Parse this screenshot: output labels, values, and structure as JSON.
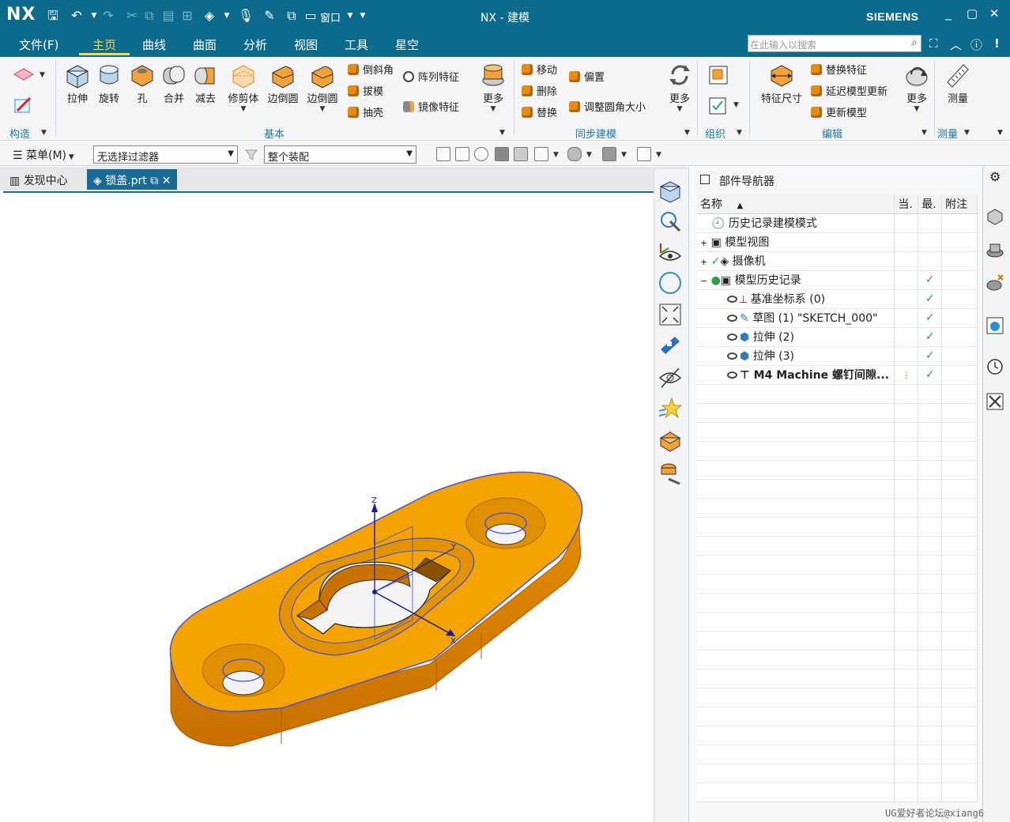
{
  "window": {
    "app_logo": "NX",
    "title": "NX - 建模",
    "brand": "SIEMENS",
    "window_menu": "窗口"
  },
  "menu": {
    "tabs": [
      "文件(F)",
      "主页",
      "曲线",
      "曲面",
      "分析",
      "视图",
      "工具",
      "星空"
    ],
    "active": "主页",
    "search_placeholder": "在此输入以搜索"
  },
  "ribbon": {
    "construct_group": "构造",
    "basic_group": "基本",
    "sync_group": "同步建模",
    "org_group": "组织",
    "edit_group": "编辑",
    "measure_group": "测量",
    "big_buttons": [
      "拉伸",
      "旋转",
      "孔",
      "合并",
      "减去",
      "修剪体",
      "边倒圆",
      "边倒圆"
    ],
    "basic_small": [
      "倒斜角",
      "拔模",
      "抽壳",
      "阵列特征",
      "镜像特征"
    ],
    "basic_more": "更多",
    "sync_small": [
      "移动",
      "删除",
      "替换",
      "偏置",
      "调整圆角大小"
    ],
    "sync_more": "更多",
    "edit_big": "特征尺寸",
    "edit_small": [
      "替换特征",
      "延迟模型更新",
      "更新模型"
    ],
    "edit_more": "更多",
    "measure_big": "测量"
  },
  "filterbar": {
    "menu_label": "菜单(M)",
    "filter": "无选择过滤器",
    "assembly": "整个装配"
  },
  "doctabs": {
    "tab1": "发现中心",
    "tab2": "锁盖.prt"
  },
  "navigator": {
    "title": "部件导航器",
    "columns": [
      "名称",
      "当.",
      "最.",
      "附注"
    ],
    "rows": [
      {
        "label": "历史记录建模模式",
        "current": "",
        "latest": "",
        "bold": false
      },
      {
        "label": "模型视图",
        "current": "",
        "latest": "",
        "bold": false
      },
      {
        "label": "摄像机",
        "current": "",
        "latest": "",
        "bold": false
      },
      {
        "label": "模型历史记录",
        "current": "",
        "latest": "✓",
        "bold": false
      },
      {
        "label": "基准坐标系 (0)",
        "current": "",
        "latest": "✓",
        "bold": false
      },
      {
        "label": "草图 (1) \"SKETCH_000\"",
        "current": "",
        "latest": "✓",
        "bold": false
      },
      {
        "label": "拉伸 (2)",
        "current": "",
        "latest": "✓",
        "bold": false
      },
      {
        "label": "拉伸 (3)",
        "current": "",
        "latest": "✓",
        "bold": false
      },
      {
        "label": "M4 Machine 螺钉间隙...",
        "current": "",
        "latest": "✓",
        "bold": true
      }
    ]
  },
  "axes": {
    "z": "Z",
    "y": "Y",
    "x": "X"
  },
  "watermark": "UG爱好者论坛@xiang6",
  "colors": {
    "titlebar": "#0c6b8c",
    "accent": "#ffd34d",
    "part": "#f5a300",
    "edge": "#3a4ff0"
  }
}
